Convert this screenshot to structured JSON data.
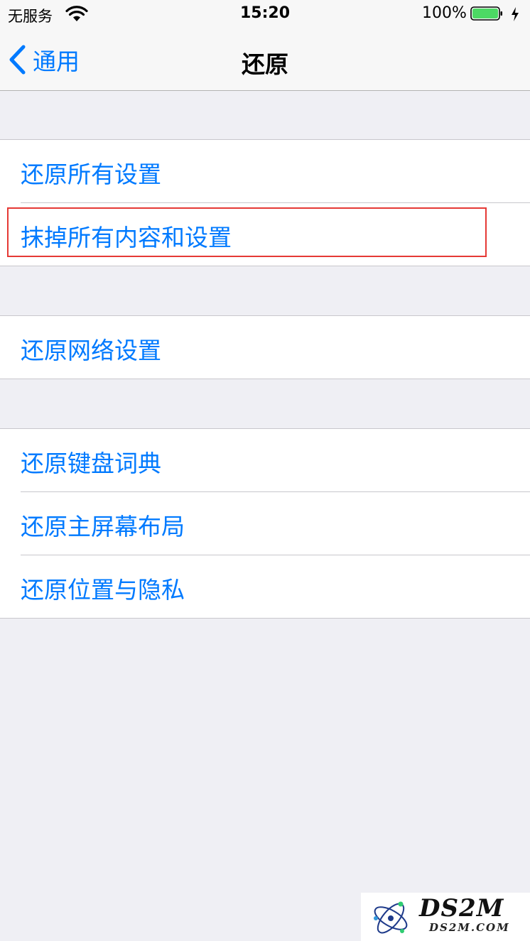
{
  "status_bar": {
    "carrier": "无服务",
    "time": "15:20",
    "battery_percent": "100%",
    "battery_level": 1.0,
    "charging": true,
    "wifi_icon": "wifi-icon"
  },
  "nav": {
    "back_label": "通用",
    "title": "还原"
  },
  "groups": [
    {
      "items": [
        {
          "label": "还原所有设置"
        },
        {
          "label": "抹掉所有内容和设置",
          "highlighted": true
        }
      ]
    },
    {
      "items": [
        {
          "label": "还原网络设置"
        }
      ]
    },
    {
      "items": [
        {
          "label": "还原键盘词典"
        },
        {
          "label": "还原主屏幕布局"
        },
        {
          "label": "还原位置与隐私"
        }
      ]
    }
  ],
  "watermark": {
    "title": "DS2M",
    "subtitle": "DS2M.COM"
  },
  "colors": {
    "accent": "#007aff",
    "highlight_border": "#e53935",
    "background": "#efeff4",
    "battery_fill": "#4cd964"
  }
}
